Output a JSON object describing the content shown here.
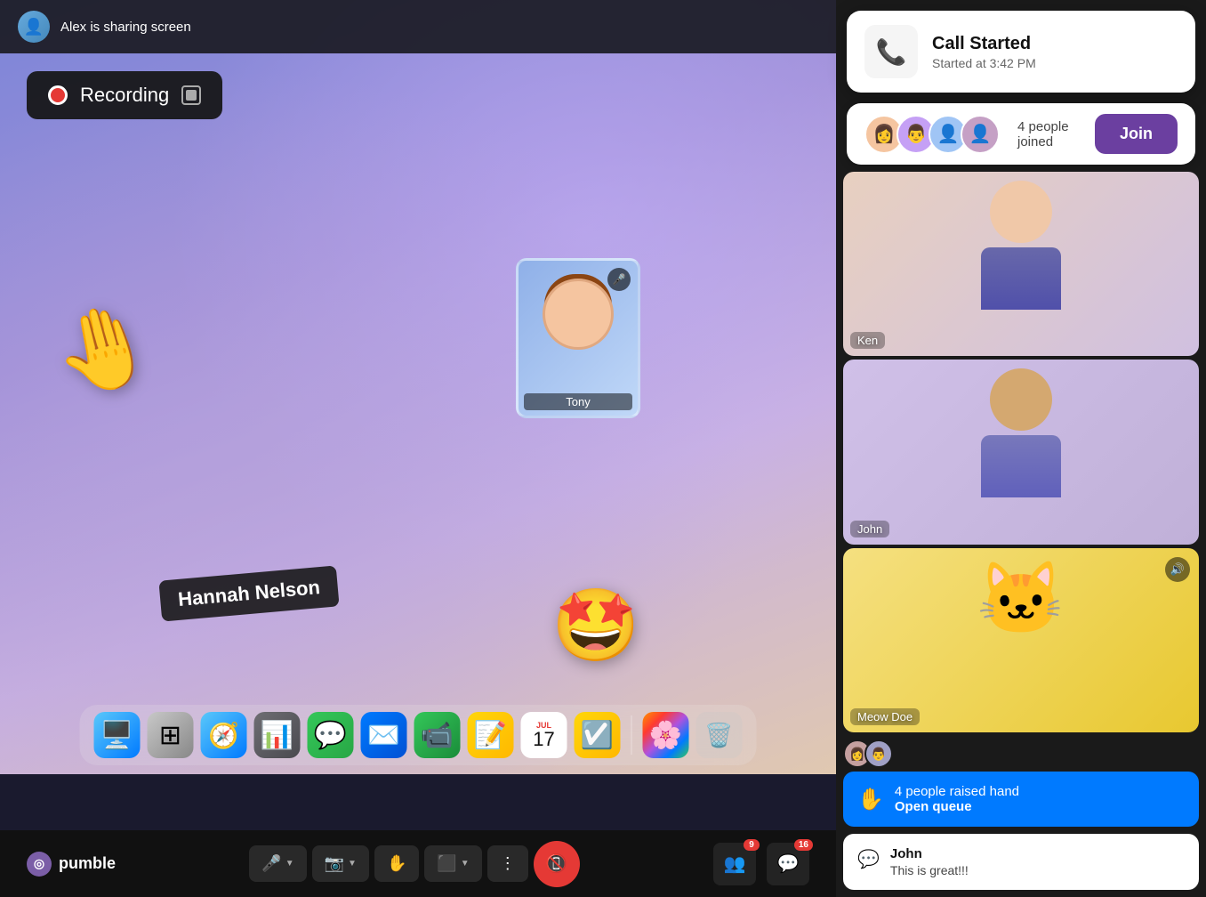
{
  "app": {
    "name": "pumble"
  },
  "screen_share": {
    "user": "Alex",
    "label": "Alex is sharing screen",
    "avatar_emoji": "👤"
  },
  "recording": {
    "label": "Recording",
    "status": "recording"
  },
  "participants": {
    "hannah_nelson": "Hannah Nelson",
    "tony": "Tony",
    "ken": "Ken",
    "john": "John",
    "meow_doe": "Meow Doe"
  },
  "call_notification": {
    "title": "Call Started",
    "subtitle": "Started at 3:42 PM",
    "icon": "📞",
    "join_label": "Join",
    "people_joined": "4 people joined"
  },
  "raised_hands": {
    "count_label": "4 people raised hand",
    "open_queue_label": "Open queue"
  },
  "message": {
    "sender": "John",
    "text": "This is great!!!"
  },
  "dock": {
    "apps": [
      {
        "name": "Finder",
        "emoji": "😊",
        "class": "finder"
      },
      {
        "name": "Launchpad",
        "emoji": "🔲",
        "class": "launchpad"
      },
      {
        "name": "Safari",
        "emoji": "🧭",
        "class": "safari"
      },
      {
        "name": "Keynote",
        "emoji": "📊",
        "class": "keynote"
      },
      {
        "name": "Messages",
        "emoji": "💬",
        "class": "messages"
      },
      {
        "name": "Mail",
        "emoji": "✉️",
        "class": "mail"
      },
      {
        "name": "FaceTime",
        "emoji": "📹",
        "class": "facetime"
      },
      {
        "name": "Notes",
        "emoji": "📝",
        "class": "notes"
      },
      {
        "name": "Calendar",
        "month": "JUL",
        "date": "17",
        "class": "calendar"
      },
      {
        "name": "Notes2",
        "emoji": "📋",
        "class": "notes2"
      },
      {
        "name": "Photos",
        "emoji": "🌸",
        "class": "photos"
      },
      {
        "name": "Trash",
        "emoji": "🗑️",
        "class": "trash"
      }
    ]
  },
  "toolbar": {
    "microphone_label": "Microphone",
    "camera_label": "Camera",
    "raise_hand_label": "Raise Hand",
    "share_screen_label": "Share Screen",
    "more_label": "More",
    "end_call_label": "End Call",
    "participants_label": "Participants",
    "chat_label": "Chat",
    "participants_badge": "9",
    "chat_badge": "16"
  }
}
